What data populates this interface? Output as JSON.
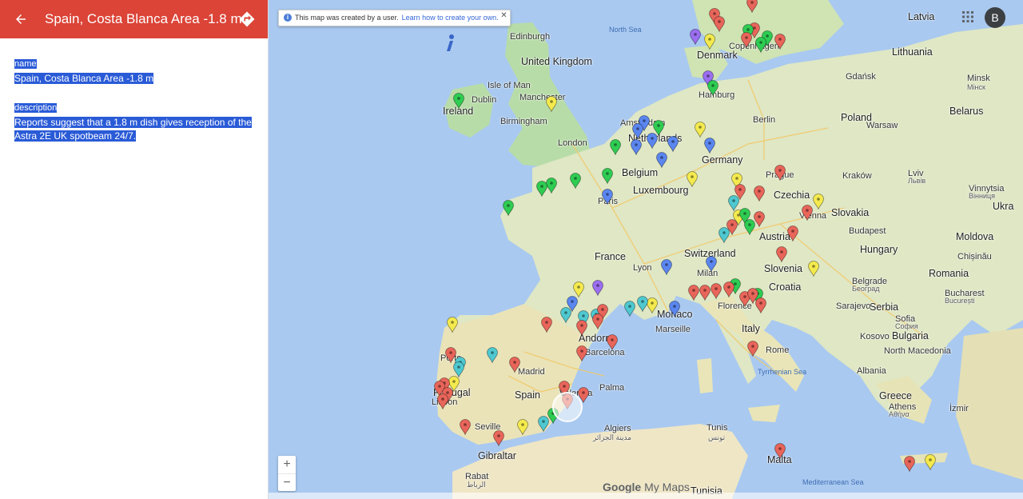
{
  "panel": {
    "title": "Spain, Costa Blanca Area -1.8 m",
    "header_color": "#db4437",
    "properties": [
      {
        "label": "name",
        "value": "Spain, Costa Blanca Area -1.8 m"
      },
      {
        "label": "description",
        "value": "Reports suggest that a 1.8 m dish gives reception of the Astra 2E UK spotbeam 24/7."
      }
    ]
  },
  "map": {
    "notice_text": "This map was created by a user.",
    "notice_link": "Learn how to create your own.",
    "zoom_in": "+",
    "zoom_out": "−",
    "avatar_letter": "B",
    "logo_text": "Google",
    "logo_suffix": "My Maps",
    "labels": [
      {
        "text": "North Sea",
        "kind": "sea"
      },
      {
        "text": "Edinburgh",
        "kind": "city"
      },
      {
        "text": "United Kingdom",
        "kind": "big"
      },
      {
        "text": "Isle of Man",
        "kind": "city"
      },
      {
        "text": "Manchester",
        "kind": "city"
      },
      {
        "text": "Dublin",
        "kind": "city"
      },
      {
        "text": "Ireland",
        "kind": "big"
      },
      {
        "text": "Birmingham",
        "kind": "city"
      },
      {
        "text": "London",
        "kind": "city"
      },
      {
        "text": "Amsterdam",
        "kind": "city"
      },
      {
        "text": "Netherlands",
        "kind": "big"
      },
      {
        "text": "Belgium",
        "kind": "big"
      },
      {
        "text": "Luxembourg",
        "kind": "big"
      },
      {
        "text": "Paris",
        "kind": "city"
      },
      {
        "text": "France",
        "kind": "big"
      },
      {
        "text": "Denmark",
        "kind": "big"
      },
      {
        "text": "Copenhagen",
        "kind": "city"
      },
      {
        "text": "Hamburg",
        "kind": "city"
      },
      {
        "text": "Berlin",
        "kind": "city"
      },
      {
        "text": "Germany",
        "kind": "big"
      },
      {
        "text": "Prague",
        "kind": "city"
      },
      {
        "text": "Czechia",
        "kind": "big"
      },
      {
        "text": "Poland",
        "kind": "big"
      },
      {
        "text": "Warsaw",
        "kind": "city"
      },
      {
        "text": "Gdańsk",
        "kind": "city"
      },
      {
        "text": "Latvia",
        "kind": "big"
      },
      {
        "text": "Lithuania",
        "kind": "big"
      },
      {
        "text": "Minsk",
        "kind": "city"
      },
      {
        "text": "Мінск",
        "kind": "small"
      },
      {
        "text": "Belarus",
        "kind": "big"
      },
      {
        "text": "Kraków",
        "kind": "city"
      },
      {
        "text": "Lviv",
        "kind": "city"
      },
      {
        "text": "Львів",
        "kind": "small"
      },
      {
        "text": "Vinnytsia",
        "kind": "city"
      },
      {
        "text": "Вінниця",
        "kind": "small"
      },
      {
        "text": "Ukra",
        "kind": "big"
      },
      {
        "text": "Slovakia",
        "kind": "big"
      },
      {
        "text": "Vienna",
        "kind": "city"
      },
      {
        "text": "Austria",
        "kind": "big"
      },
      {
        "text": "Budapest",
        "kind": "city"
      },
      {
        "text": "Hungary",
        "kind": "big"
      },
      {
        "text": "Moldova",
        "kind": "big"
      },
      {
        "text": "Chișinău",
        "kind": "city"
      },
      {
        "text": "Romania",
        "kind": "big"
      },
      {
        "text": "Bucharest",
        "kind": "city"
      },
      {
        "text": "București",
        "kind": "small"
      },
      {
        "text": "Switzerland",
        "kind": "big"
      },
      {
        "text": "Milan",
        "kind": "city"
      },
      {
        "text": "Lyon",
        "kind": "city"
      },
      {
        "text": "Slovenia",
        "kind": "big"
      },
      {
        "text": "Croatia",
        "kind": "big"
      },
      {
        "text": "Belgrade",
        "kind": "city"
      },
      {
        "text": "Београд",
        "kind": "small"
      },
      {
        "text": "Serbia",
        "kind": "big"
      },
      {
        "text": "Sarajevo",
        "kind": "city"
      },
      {
        "text": "Sofia",
        "kind": "city"
      },
      {
        "text": "София",
        "kind": "small"
      },
      {
        "text": "Bulgaria",
        "kind": "big"
      },
      {
        "text": "Kosovo",
        "kind": "city"
      },
      {
        "text": "North Macedonia",
        "kind": "city"
      },
      {
        "text": "Albania",
        "kind": "city"
      },
      {
        "text": "Greece",
        "kind": "big"
      },
      {
        "text": "Athens",
        "kind": "city"
      },
      {
        "text": "Αθήνα",
        "kind": "small"
      },
      {
        "text": "İzmir",
        "kind": "city"
      },
      {
        "text": "Florence",
        "kind": "city"
      },
      {
        "text": "Monaco",
        "kind": "big"
      },
      {
        "text": "Marseille",
        "kind": "city"
      },
      {
        "text": "Italy",
        "kind": "big"
      },
      {
        "text": "Rome",
        "kind": "city"
      },
      {
        "text": "Tyrrhenian Sea",
        "kind": "sea"
      },
      {
        "text": "Andorra",
        "kind": "big"
      },
      {
        "text": "Barcelona",
        "kind": "city"
      },
      {
        "text": "Madrid",
        "kind": "city"
      },
      {
        "text": "Spain",
        "kind": "big"
      },
      {
        "text": "Valencia",
        "kind": "city"
      },
      {
        "text": "Palma",
        "kind": "city"
      },
      {
        "text": "Porto",
        "kind": "city"
      },
      {
        "text": "Portugal",
        "kind": "big"
      },
      {
        "text": "Lisbon",
        "kind": "city"
      },
      {
        "text": "Seville",
        "kind": "city"
      },
      {
        "text": "Gibraltar",
        "kind": "big"
      },
      {
        "text": "Algiers",
        "kind": "city"
      },
      {
        "text": "مدينة الجزائر",
        "kind": "small"
      },
      {
        "text": "Rabat",
        "kind": "city"
      },
      {
        "text": "الرباط",
        "kind": "small"
      },
      {
        "text": "Tunis",
        "kind": "city"
      },
      {
        "text": "تونس",
        "kind": "small"
      },
      {
        "text": "Tunisia",
        "kind": "big"
      },
      {
        "text": "Malta",
        "kind": "big"
      },
      {
        "text": "Mediterranean Sea",
        "kind": "sea"
      }
    ],
    "pins": [
      {
        "color": "#e8655a"
      },
      {
        "color": "#e8655a"
      },
      {
        "color": "#e8655a"
      },
      {
        "color": "#e8655a"
      },
      {
        "color": "#e8655a"
      },
      {
        "color": "#9b6ef0"
      },
      {
        "color": "#f4ea4e"
      },
      {
        "color": "#2ecc52"
      },
      {
        "color": "#2ecc52"
      },
      {
        "color": "#2ecc52"
      },
      {
        "color": "#e8655a"
      },
      {
        "color": "#9b6ef0"
      },
      {
        "color": "#2ecc52"
      },
      {
        "color": "#2ecc52"
      },
      {
        "color": "#f4ea4e"
      },
      {
        "color": "#5b86f0"
      },
      {
        "color": "#5b86f0"
      },
      {
        "color": "#2ecc52"
      },
      {
        "color": "#5b86f0"
      },
      {
        "color": "#5b86f0"
      },
      {
        "color": "#f4ea4e"
      },
      {
        "color": "#5b86f0"
      },
      {
        "color": "#2ecc52"
      },
      {
        "color": "#2ecc52"
      },
      {
        "color": "#5b86f0"
      },
      {
        "color": "#5b86f0"
      },
      {
        "color": "#2ecc52"
      },
      {
        "color": "#2ecc52"
      },
      {
        "color": "#2ecc52"
      },
      {
        "color": "#5b86f0"
      },
      {
        "color": "#2ecc52"
      },
      {
        "color": "#f4ea4e"
      },
      {
        "color": "#e8655a"
      },
      {
        "color": "#f4ea4e"
      },
      {
        "color": "#e8655a"
      },
      {
        "color": "#e8655a"
      },
      {
        "color": "#4fc8d0"
      },
      {
        "color": "#f4ea4e"
      },
      {
        "color": "#2ecc52"
      },
      {
        "color": "#2ecc52"
      },
      {
        "color": "#e8655a"
      },
      {
        "color": "#e8655a"
      },
      {
        "color": "#f4ea4e"
      },
      {
        "color": "#e8655a"
      },
      {
        "color": "#4fc8d0"
      },
      {
        "color": "#e8655a"
      },
      {
        "color": "#e8655a"
      },
      {
        "color": "#5b86f0"
      },
      {
        "color": "#5b86f0"
      },
      {
        "color": "#f4ea4e"
      },
      {
        "color": "#e8655a"
      },
      {
        "color": "#f4ea4e"
      },
      {
        "color": "#9b6ef0"
      },
      {
        "color": "#5b86f0"
      },
      {
        "color": "#4fc8d0"
      },
      {
        "color": "#4fc8d0"
      },
      {
        "color": "#4fc8d0"
      },
      {
        "color": "#f4ea4e"
      },
      {
        "color": "#5b86f0"
      },
      {
        "color": "#2ecc52"
      },
      {
        "color": "#e8655a"
      },
      {
        "color": "#e8655a"
      },
      {
        "color": "#e8655a"
      },
      {
        "color": "#e8655a"
      },
      {
        "color": "#2ecc52"
      },
      {
        "color": "#e8655a"
      },
      {
        "color": "#e8655a"
      },
      {
        "color": "#e8655a"
      },
      {
        "color": "#4fc8d0"
      },
      {
        "color": "#4fc8d0"
      },
      {
        "color": "#e8655a"
      },
      {
        "color": "#e8655a"
      },
      {
        "color": "#e8655a"
      },
      {
        "color": "#e8655a"
      },
      {
        "color": "#e8655a"
      },
      {
        "color": "#f4ea4e"
      },
      {
        "color": "#e8655a"
      },
      {
        "color": "#f4ea4e"
      },
      {
        "color": "#4fc8d0"
      },
      {
        "color": "#4fc8d0"
      },
      {
        "color": "#4fc8d0"
      },
      {
        "color": "#e8655a"
      },
      {
        "color": "#e8655a"
      },
      {
        "color": "#e8655a"
      },
      {
        "color": "#e8655a"
      },
      {
        "color": "#e8655a"
      },
      {
        "color": "#e8655a"
      },
      {
        "color": "#e8655a"
      },
      {
        "color": "#f4ea4e"
      },
      {
        "color": "#4fc8d0"
      },
      {
        "color": "#2ecc52"
      },
      {
        "color": "#e8655a"
      },
      {
        "color": "#e8655a"
      },
      {
        "color": "#e8655a"
      },
      {
        "color": "#e8655a"
      },
      {
        "color": "#e8655a"
      },
      {
        "color": "#e8655a"
      },
      {
        "color": "#f4ea4e"
      }
    ]
  }
}
